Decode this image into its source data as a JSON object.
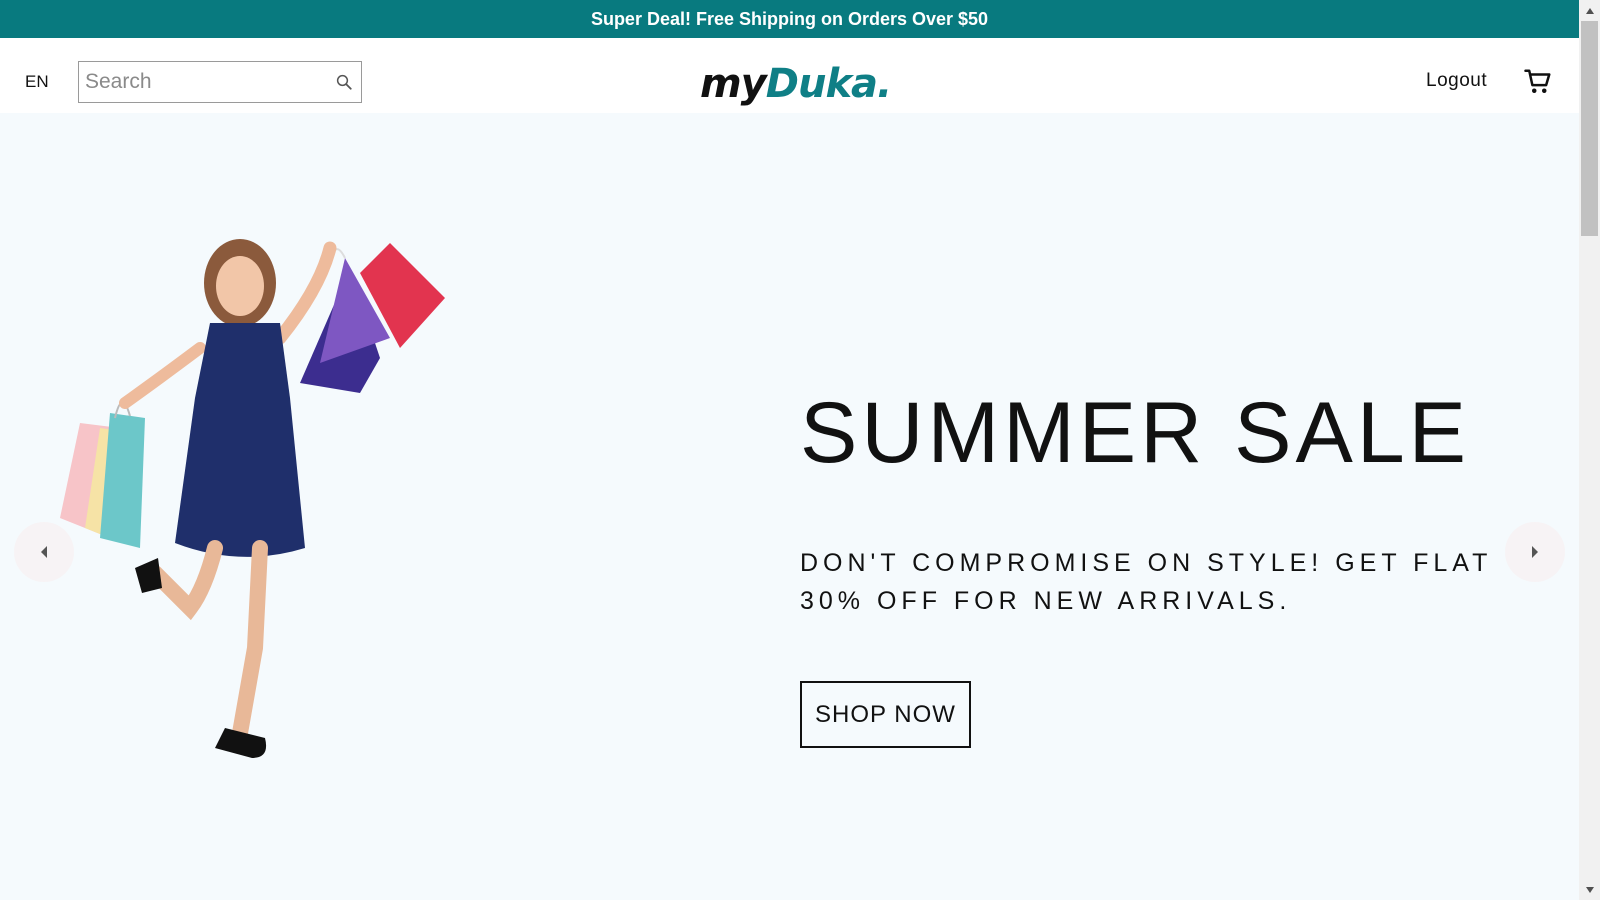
{
  "announcement": {
    "text": "Super Deal! Free Shipping on Orders Over $50"
  },
  "header": {
    "language": "EN",
    "search": {
      "placeholder": "Search",
      "value": ""
    },
    "logo": {
      "part1": "my",
      "part2": "Duka",
      "part3": "."
    },
    "logout_label": "Logout",
    "icons": {
      "search": "search-icon",
      "cart": "shopping-cart-icon"
    }
  },
  "hero": {
    "title": "SUMMER SALE",
    "subtitle": "DON'T COMPROMISE ON STYLE! GET FLAT 30% OFF FOR NEW ARRIVALS.",
    "cta_label": "SHOP NOW",
    "icons": {
      "prev": "chevron-left-icon",
      "next": "chevron-right-icon"
    }
  },
  "colors": {
    "brand": "#087a7f",
    "logo_accent": "#0f7f86",
    "hero_bg": "#f5fafd",
    "text": "#111111"
  }
}
